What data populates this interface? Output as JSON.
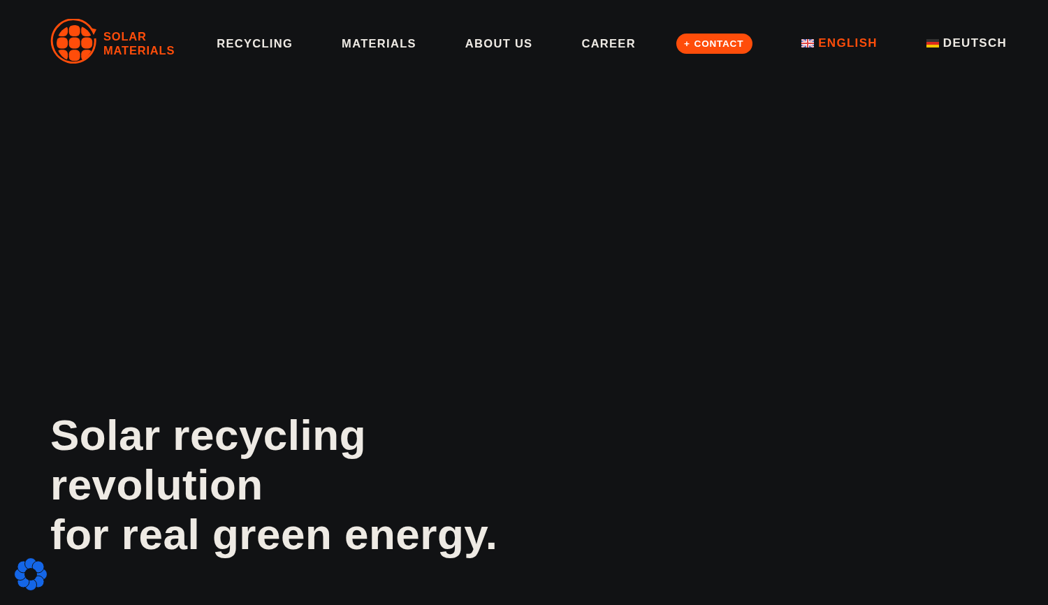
{
  "logo": {
    "line_1": "SOLAR",
    "line_2": "MATERIALS"
  },
  "nav": [
    {
      "label": "RECYCLING"
    },
    {
      "label": "MATERIALS"
    },
    {
      "label": "ABOUT US"
    },
    {
      "label": "CAREER"
    }
  ],
  "contact_button": {
    "icon": "+",
    "label": "CONTACT"
  },
  "languages": [
    {
      "kind": "uk",
      "label": "ENGLISH",
      "selected": true
    },
    {
      "kind": "de",
      "label": "DEUTSCH",
      "selected": false
    }
  ],
  "hero": {
    "headline_lines": [
      "Solar recycling",
      "revolution",
      "for real green energy."
    ]
  }
}
